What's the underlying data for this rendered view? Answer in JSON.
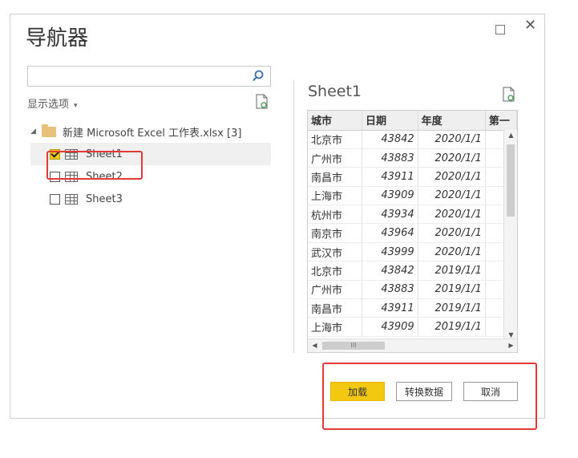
{
  "window": {
    "maximize_icon": "maximize-icon",
    "close_label": "✕"
  },
  "title": "导航器",
  "search": {
    "placeholder": "",
    "icon": "search-icon"
  },
  "display_options": {
    "label": "显示选项",
    "caret": "▾"
  },
  "tree": {
    "root": {
      "label": "新建 Microsoft Excel 工作表.xlsx [3]",
      "expander": "◢"
    },
    "sheets": [
      {
        "label": "Sheet1",
        "checked": true
      },
      {
        "label": "Sheet2",
        "checked": false
      },
      {
        "label": "Sheet3",
        "checked": false
      }
    ]
  },
  "preview": {
    "title": "Sheet1",
    "columns": [
      "城市",
      "日期",
      "年度",
      "第一"
    ],
    "rows": [
      [
        "北京市",
        "43842",
        "2020/1/1"
      ],
      [
        "广州市",
        "43883",
        "2020/1/1"
      ],
      [
        "南昌市",
        "43911",
        "2020/1/1"
      ],
      [
        "上海市",
        "43909",
        "2020/1/1"
      ],
      [
        "杭州市",
        "43934",
        "2020/1/1"
      ],
      [
        "南京市",
        "43964",
        "2020/1/1"
      ],
      [
        "武汉市",
        "43999",
        "2020/1/1"
      ],
      [
        "北京市",
        "43842",
        "2019/1/1"
      ],
      [
        "广州市",
        "43883",
        "2019/1/1"
      ],
      [
        "南昌市",
        "43911",
        "2019/1/1"
      ],
      [
        "上海市",
        "43909",
        "2019/1/1"
      ]
    ],
    "hscroll_grip": "III"
  },
  "buttons": {
    "load": "加载",
    "transform": "转换数据",
    "cancel": "取消"
  },
  "colors": {
    "accent": "#f2c811",
    "highlight": "#e53935"
  }
}
